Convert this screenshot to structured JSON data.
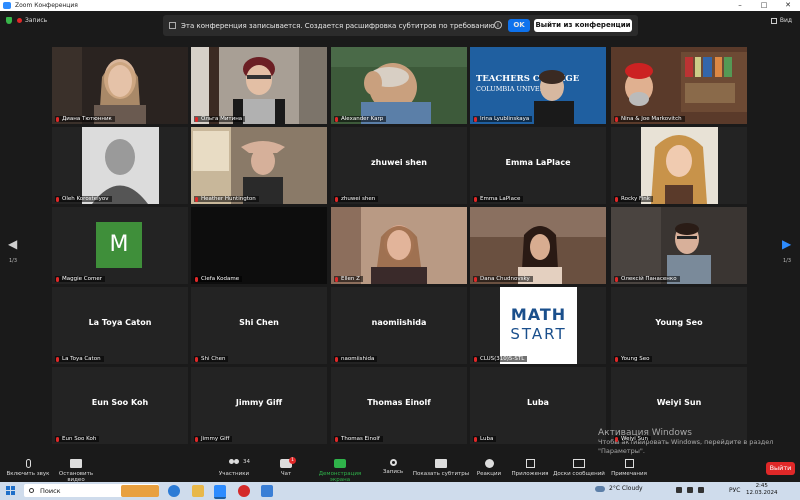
{
  "window": {
    "title": "Zoom Конференция"
  },
  "topbar": {
    "recording_label": "Запись",
    "view_label": "Вид"
  },
  "banner": {
    "message": "Эта конференция записывается. Создается расшифровка субтитров по требованию.",
    "ok_label": "OK",
    "leave_label": "Выйти из конференции"
  },
  "pager": {
    "left": "1/3",
    "right": "1/3"
  },
  "tiles": [
    {
      "name": "Диана Тютюнник",
      "big": ""
    },
    {
      "name": "Ольга Митина",
      "big": ""
    },
    {
      "name": "Alexander Karp",
      "big": ""
    },
    {
      "name": "Irina Lyublinskaya",
      "big": "",
      "poster_line1": "TEACHERS COLLEGE",
      "poster_line2": "COLUMBIA UNIVERSITY"
    },
    {
      "name": "Nina & Joe Markovitch",
      "big": ""
    },
    {
      "name": "Oleh Korostelyov",
      "big": ""
    },
    {
      "name": "Heather Huntington",
      "big": ""
    },
    {
      "name": "zhuwei shen",
      "big": "zhuwei shen"
    },
    {
      "name": "Emma LaPlace",
      "big": "Emma LaPlace"
    },
    {
      "name": "Rocky Fink",
      "big": ""
    },
    {
      "name": "Maggie Comer",
      "big": "",
      "avatar": "M"
    },
    {
      "name": "Clefa Kodame",
      "big": ""
    },
    {
      "name": "Ellen Z",
      "big": ""
    },
    {
      "name": "Dana Chudnovsky",
      "big": ""
    },
    {
      "name": "Олексій Панасенко",
      "big": ""
    },
    {
      "name": "La Toya Caton",
      "big": "La Toya Caton"
    },
    {
      "name": "Shi Chen",
      "big": "Shi Chen"
    },
    {
      "name": "naomiishida",
      "big": "naomiishida"
    },
    {
      "name": "CLUS(310)5-STL",
      "big": "",
      "logo_line1": "MATH",
      "logo_line2": "START"
    },
    {
      "name": "Young Seo",
      "big": "Young  Seo"
    },
    {
      "name": "Eun Soo Koh",
      "big": "Eun Soo Koh"
    },
    {
      "name": "Jimmy Giff",
      "big": "Jimmy Giff"
    },
    {
      "name": "Thomas Einolf",
      "big": "Thomas Einolf"
    },
    {
      "name": "Luba",
      "big": "Luba"
    },
    {
      "name": "Weiyi Sun",
      "big": "Weiyi Sun"
    }
  ],
  "watermark": {
    "line1": "Активация Windows",
    "line2": "Чтобы активировать Windows, перейдите в раздел",
    "line3": "\"Параметры\"."
  },
  "toolbar": {
    "unmute": "Включить звук",
    "start_video": "Остановить видео",
    "participants": "Участники",
    "participants_count": "34",
    "chat": "Чат",
    "chat_badge": "1",
    "share": "Демонстрация экрана",
    "record": "Запись",
    "captions": "Показать субтитры",
    "reactions": "Реакции",
    "apps": "Приложения",
    "whiteboard": "Доски сообщений",
    "notes": "Примечания",
    "end": "Выйти"
  },
  "taskbar": {
    "search": "Поиск",
    "weather": "2°C  Cloudy",
    "lang": "РУС",
    "time": "2:45",
    "date": "12.03.2024"
  },
  "colors": {
    "active_speaker": "#c8d93a",
    "end_button": "#e02828",
    "ok_button": "#0e72ed"
  }
}
